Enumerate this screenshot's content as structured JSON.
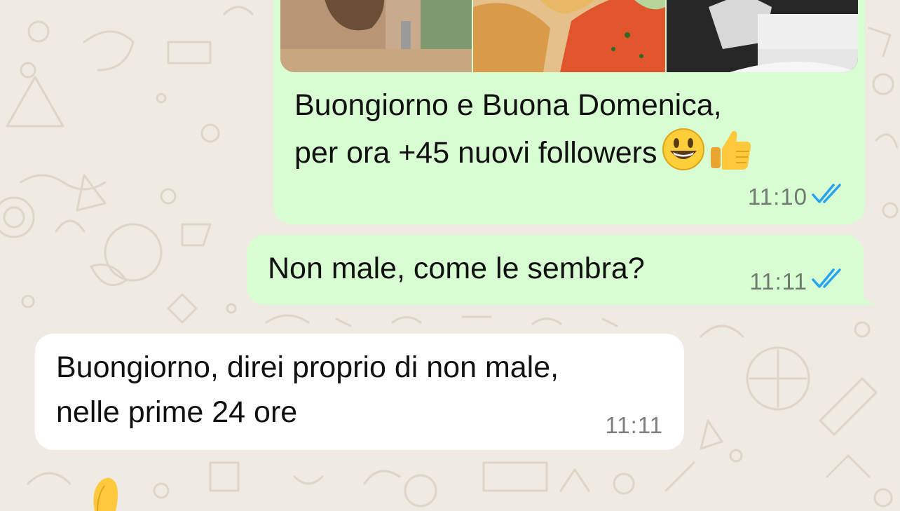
{
  "chat": {
    "messages": [
      {
        "direction": "outgoing",
        "type": "media-album",
        "caption_line1": "Buongiorno e Buona Domenica,",
        "caption_line2": "per ora +45 nuovi followers",
        "emojis": [
          "smiling-face-icon",
          "thumbs-up-icon"
        ],
        "time": "11:10",
        "status": "read"
      },
      {
        "direction": "outgoing",
        "type": "text",
        "text": "Non male, come le sembra?",
        "time": "11:11",
        "status": "read"
      },
      {
        "direction": "incoming",
        "type": "text",
        "text_line1": "Buongiorno, direi proprio di non male,",
        "text_line2": "nelle prime 24 ore",
        "time": "11:11"
      }
    ]
  },
  "colors": {
    "wallpaper": "#efeae2",
    "outgoing_bubble": "#d9fdd3",
    "incoming_bubble": "#ffffff",
    "read_ticks": "#27a3f1",
    "timestamp": "#6f7a70"
  }
}
